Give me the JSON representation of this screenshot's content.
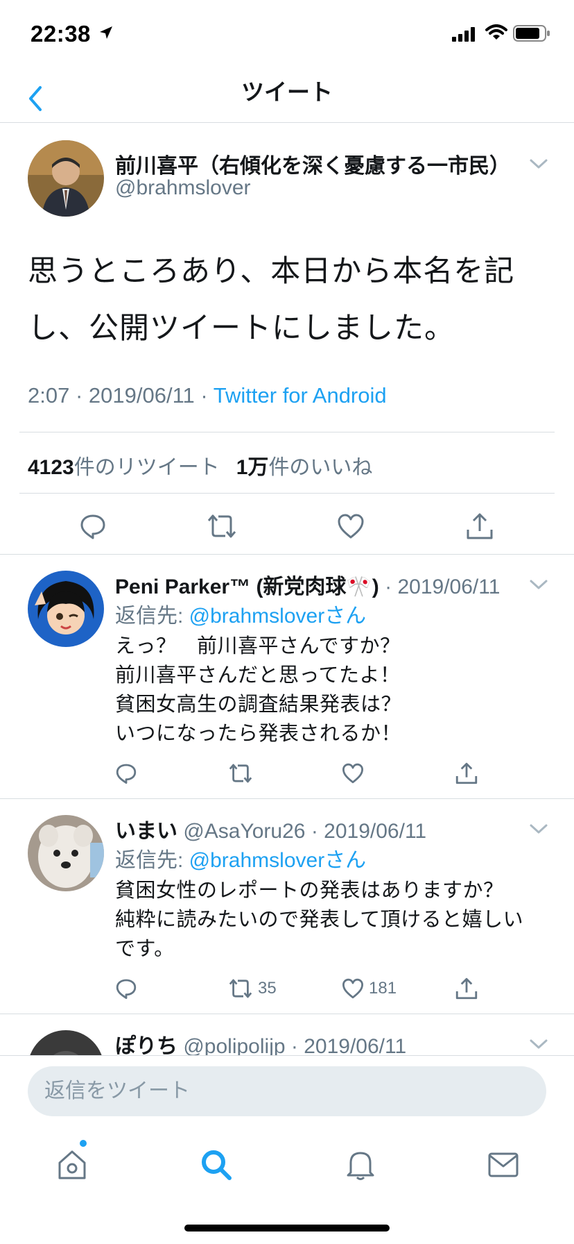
{
  "status_bar": {
    "time": "22:38"
  },
  "nav": {
    "title": "ツイート"
  },
  "main_tweet": {
    "author_name": "前川喜平（右傾化を深く憂慮する一市民）",
    "handle": "@brahmslover",
    "text": "思うところあり、本日から本名を記し、公開ツイートにしました。",
    "time": "2:07",
    "date": "2019/06/11",
    "source": "Twitter for Android",
    "sep": "·",
    "retweet_count": "4123",
    "retweet_label": "件のリツイート",
    "like_count": "1万",
    "like_label": "件のいいね"
  },
  "replies": [
    {
      "name": "Peni Parker™ (新党肉球🎌)",
      "handle": "",
      "date": "2019/06/11",
      "sep": "·",
      "reply_to_label": "返信先: ",
      "reply_to_handle": "@brahmsloverさん",
      "text_lines": [
        "えっ？　前川喜平さんですか？",
        "前川喜平さんだと思ってたよ！",
        "貧困女高生の調査結果発表は？",
        "いつになったら発表されるか！"
      ],
      "retweets": "",
      "likes": ""
    },
    {
      "name": "いまい",
      "handle": "@AsaYoru26",
      "date": "2019/06/11",
      "sep": "·",
      "reply_to_label": "返信先: ",
      "reply_to_handle": "@brahmsloverさん",
      "text_lines": [
        "貧困女性のレポートの発表はありますか？",
        "純粋に読みたいので発表して頂けると嬉しい",
        "です。"
      ],
      "retweets": "35",
      "likes": "181"
    },
    {
      "name": "ぽりち",
      "handle": "@polipolijp",
      "date": "2019/06/11",
      "sep": "·"
    }
  ],
  "composer": {
    "placeholder": "返信をツイート"
  },
  "colors": {
    "accent": "#1da1f2",
    "text": "#14171a",
    "muted": "#657786",
    "divider": "#d8dde1"
  },
  "icons": [
    "back-chevron-icon",
    "location-arrow-icon",
    "signal-icon",
    "wifi-icon",
    "battery-icon",
    "reply-icon",
    "retweet-icon",
    "like-icon",
    "share-icon",
    "home-icon",
    "search-icon",
    "bell-icon",
    "mail-icon",
    "caret-down-icon"
  ]
}
